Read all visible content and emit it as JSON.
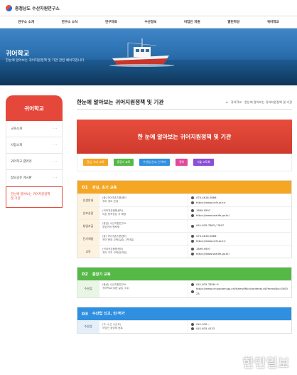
{
  "header": {
    "brand": "충청남도 수산자원연구소"
  },
  "nav": [
    "연구소 소개",
    "연구소 소식",
    "연구자료",
    "수산정보",
    "어업인 지원",
    "열린마당",
    "귀어학교"
  ],
  "hero": {
    "title": "귀어학교",
    "subtitle": "한눈에 알아보는 귀어지원정책 및 기관 관련 페이지입니다."
  },
  "sidebar": {
    "title": "귀어학교",
    "items": [
      "교육소개",
      "사업소개",
      "귀어학교 갤러리",
      "정보공유 게시판",
      "한눈에 알아보는 귀어지원정책 및 기관"
    ]
  },
  "page": {
    "title": "한눈에 알아보는 귀어지원정책 및 기관",
    "breadcrumb_home": "⌂",
    "breadcrumb_1": "귀어학교",
    "breadcrumb_2": "한눈에 알아보는 귀어지원정책 및 기관",
    "banner": "한 눈에 알아보는 귀어지원정책 및 기관"
  },
  "tabs": [
    {
      "label": "관심, 초기 교육",
      "color": "#f5a623"
    },
    {
      "label": "중장기 교육",
      "color": "#56b947"
    },
    {
      "label": "수산업 신고, 인·허가",
      "color": "#2f8fe0"
    },
    {
      "label": "정착",
      "color": "#e04a9b"
    },
    {
      "label": "기술 고도화",
      "color": "#8a4fd6"
    }
  ],
  "sections": [
    {
      "num": "01",
      "title": "관심, 초기 교육",
      "color": "#f5a623",
      "rowbg": "#fdf2dd",
      "rows": [
        {
          "label": "인생안내",
          "mid": "(종) 귀어귀촌지원센터\n귀어 개요 안내",
          "right": [
            "070-4616-3666",
            "https://www.cnfv.or.kr/"
          ]
        },
        {
          "label": "상호상담",
          "mid": "(귀어귀촌종합센터)\n어촌 정착상담 사 배정",
          "right": [
            "1899-9597",
            "https://www.sealife.go.kr/"
          ]
        },
        {
          "label": "창업자금",
          "mid": "(충남) 수산자원연구소\n창업귀어 멘토링",
          "right": [
            "041-635-7863 / 7697",
            ""
          ]
        },
        {
          "label": "단기체험",
          "mid": "(종) 귀어귀촌지원센터\n귀어 현장 교육(실습, 2박3일)",
          "right": [
            "070-4616-3666",
            "https://www.cnfv.or.kr/"
          ]
        },
        {
          "label": "교육",
          "mid": "(귀어귀촌종합센터)\n귀어 기초 교육(온라인)",
          "right": [
            "1899-9597",
            "https://www.sealife.go.kr/"
          ]
        }
      ]
    },
    {
      "num": "02",
      "title": "중장기 교육",
      "color": "#56b947",
      "rowbg": "#e9f6e5",
      "rows": [
        {
          "label": "수산업",
          "mid": "(충남) 수산자원연구소\n귀어학교(이론·실습, 5주)",
          "right": [
            "041-635-7858~9",
            "https://www.chungnam.go.kr/fisheryMain/contents.do?menuNo=500025"
          ]
        }
      ]
    },
    {
      "num": "03",
      "title": "수산업 신고, 인·허가",
      "color": "#2f8fe0",
      "rowbg": "#e3effb",
      "rows": [
        {
          "label": "수산업",
          "mid": "(각 시·군 수산과)\n어업인 경영체 등록",
          "right": [
            "041-930-...",
            "041-635-4133"
          ]
        }
      ]
    }
  ],
  "watermark": "한민일보"
}
